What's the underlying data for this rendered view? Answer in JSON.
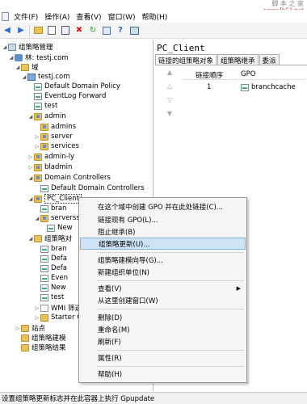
{
  "watermark": {
    "name": "脚 本 之 家",
    "url": "www.Jb51.net"
  },
  "menubar": {
    "items": [
      "文件(F)",
      "操作(A)",
      "查看(V)",
      "窗口(W)",
      "帮助(H)"
    ]
  },
  "toolbar": {
    "buttons": [
      "back-arrow",
      "forward-arrow",
      "folder",
      "properties",
      "copy",
      "delete",
      "refresh",
      "export",
      "help",
      "console"
    ]
  },
  "tree": {
    "root": "组策略管理",
    "forest": "林: testj.com",
    "domains": "域",
    "domain": "testj.com",
    "ddp": "Default Domain Policy",
    "eventlog": "EventLog Forward",
    "test": "test",
    "admin": "admin",
    "admins": "admins",
    "server": "server",
    "services": "services",
    "adminly": "admin-ly",
    "bladmin": "bladmin",
    "dc": "Domain Controllers",
    "ddcp": "Default Domain Controllers",
    "pcclient": "PC_Client",
    "bran1": "bran",
    "serverss": "serverss",
    "new1": "New",
    "gpo_objects": "组策略对",
    "bran2": "bran",
    "defa1": "Defa",
    "defa2": "Defa",
    "even": "Even",
    "new2": "New",
    "test2": "test",
    "wmi": "WMI 筛选",
    "starter": "Starter G",
    "sites": "站点",
    "modeling": "组策略建模",
    "results": "组策略结果"
  },
  "right_pane": {
    "title": "PC_Client",
    "tabs": [
      "链接的组策略对象",
      "组策略继承",
      "委派"
    ],
    "columns": [
      "链接顺序",
      "GPO"
    ],
    "rows": [
      {
        "order": "1",
        "gpo": "branchcache"
      }
    ]
  },
  "context_menu": {
    "items": [
      "在这个域中创建 GPO 并在此处链接(C)...",
      "链接现有 GPO(L)...",
      "阻止继承(B)",
      "组策略更新(U)...",
      "组策略建模向导(G)...",
      "新建组织单位(N)",
      "查看(V)",
      "从这里创建窗口(W)",
      "删除(D)",
      "重命名(M)",
      "刷新(F)",
      "属性(R)",
      "帮助(H)"
    ]
  },
  "status": {
    "text": "设置组策略更新标志并在此容器上执行 Gpupdate"
  }
}
